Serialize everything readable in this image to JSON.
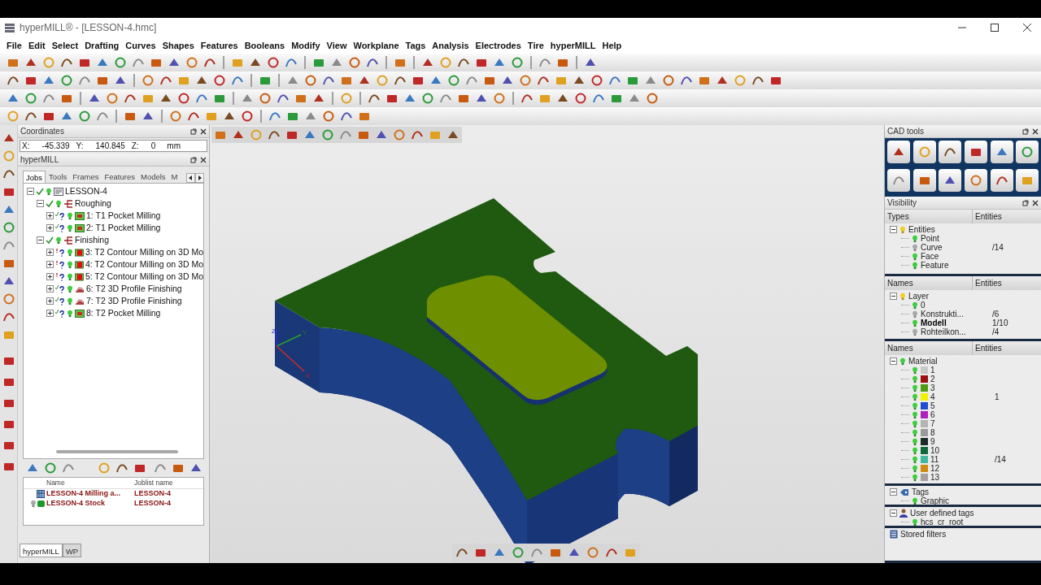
{
  "window": {
    "title": "hyperMILL® - [LESSON-4.hmc]"
  },
  "menu": [
    "File",
    "Edit",
    "Select",
    "Drafting",
    "Curves",
    "Shapes",
    "Features",
    "Booleans",
    "Modify",
    "View",
    "Workplane",
    "Tags",
    "Analysis",
    "Electrodes",
    "Tire",
    "hyperMILL",
    "Help"
  ],
  "coordinates": {
    "title": "Coordinates",
    "fields": [
      {
        "label": "X:",
        "value": "-45.339"
      },
      {
        "label": "Y:",
        "value": "140.845"
      },
      {
        "label": "Z:",
        "value": "0"
      }
    ],
    "unit": "mm"
  },
  "hypermill": {
    "title": "hyperMILL",
    "tabs": [
      {
        "label": "Jobs",
        "selected": true
      },
      {
        "label": "Tools",
        "selected": false
      },
      {
        "label": "Frames",
        "selected": false
      },
      {
        "label": "Features",
        "selected": false
      },
      {
        "label": "Models",
        "selected": false
      },
      {
        "label": "M",
        "selected": false
      }
    ],
    "tree": [
      {
        "label": "LESSON-4",
        "kind": "joblist",
        "expanded": true,
        "children": [
          {
            "label": "Roughing",
            "kind": "group",
            "expanded": true,
            "children": [
              {
                "label": "1: T1 Pocket Milling",
                "kind": "pocket",
                "expanded": false,
                "warning": false
              },
              {
                "label": "2: T1 Pocket Milling",
                "kind": "pocket",
                "expanded": false,
                "warning": false
              }
            ]
          },
          {
            "label": "Finishing",
            "kind": "group",
            "expanded": true,
            "children": [
              {
                "label": "3: T2 Contour Milling on 3D Mo",
                "kind": "contour",
                "expanded": false,
                "warning": true
              },
              {
                "label": "4: T2 Contour Milling on 3D Mo",
                "kind": "contour",
                "expanded": false,
                "warning": true
              },
              {
                "label": "5: T2 Contour Milling on 3D Mo",
                "kind": "contour",
                "expanded": false,
                "warning": true
              },
              {
                "label": "6: T2 3D Profile Finishing",
                "kind": "profile",
                "expanded": false,
                "warning": false
              },
              {
                "label": "7: T2 3D Profile Finishing",
                "kind": "profile",
                "expanded": false,
                "warning": false
              },
              {
                "label": "8: T2 Pocket Milling",
                "kind": "pocket",
                "expanded": false,
                "warning": false
              }
            ]
          }
        ]
      }
    ],
    "models": {
      "columns": [
        "Name",
        "Joblist name"
      ],
      "rows": [
        {
          "name": "LESSON-4 Milling a...",
          "joblist": "LESSON-4",
          "kind": "mesh"
        },
        {
          "name": "LESSON-4 Stock",
          "joblist": "LESSON-4",
          "kind": "stock"
        }
      ]
    },
    "bottom_tabs": [
      {
        "label": "hyperMILL",
        "selected": true
      },
      {
        "label": "WP",
        "selected": false
      }
    ]
  },
  "viewport": {
    "axes": [
      "Z",
      "Y",
      "X"
    ]
  },
  "cad_tools": {
    "title": "CAD tools"
  },
  "visibility": {
    "title": "Visibility",
    "sections": [
      {
        "columns": [
          "Types",
          "Entities"
        ],
        "tree": [
          {
            "label": "Entities",
            "kind": "folder",
            "children": [
              {
                "label": "Point",
                "visible": true
              },
              {
                "label": "Curve",
                "visible": false,
                "entities": "/14"
              },
              {
                "label": "Face",
                "visible": true
              },
              {
                "label": "Feature",
                "visible": true
              }
            ]
          }
        ]
      },
      {
        "columns": [
          "Names",
          "Entities"
        ],
        "tree": [
          {
            "label": "Layer",
            "kind": "folder",
            "children": [
              {
                "label": "0",
                "visible": true
              },
              {
                "label": "Konstrukti...",
                "visible": false,
                "entities": "/6"
              },
              {
                "label": "Modell",
                "visible": true,
                "active": true,
                "entities": "1/10"
              },
              {
                "label": "Rohteilkon...",
                "visible": false,
                "entities": "/4"
              }
            ]
          }
        ]
      },
      {
        "columns": [
          "Names",
          "Entities"
        ],
        "tree": [
          {
            "label": "Material",
            "visible": true,
            "children": [
              {
                "label": "1",
                "visible": true,
                "color": "#c8c8c8"
              },
              {
                "label": "2",
                "visible": true,
                "color": "#9b1010"
              },
              {
                "label": "3",
                "visible": true,
                "color": "#4f9a10"
              },
              {
                "label": "4",
                "visible": true,
                "color": "#f2f200",
                "entities": "1"
              },
              {
                "label": "5",
                "visible": true,
                "color": "#1f4fd0"
              },
              {
                "label": "6",
                "visible": true,
                "color": "#b020c0"
              },
              {
                "label": "7",
                "visible": true,
                "color": "#b4b4b4"
              },
              {
                "label": "8",
                "visible": true,
                "color": "#9a9a9a"
              },
              {
                "label": "9",
                "visible": true,
                "color": "#1c2a2a"
              },
              {
                "label": "10",
                "visible": true,
                "color": "#0f6a3a"
              },
              {
                "label": "11",
                "visible": true,
                "color": "#40b8a0",
                "entities": "/14"
              },
              {
                "label": "12",
                "visible": true,
                "color": "#d08a10"
              },
              {
                "label": "13",
                "visible": true,
                "color": "#a8a0a0"
              }
            ]
          }
        ]
      },
      {
        "tree": [
          {
            "label": "Tags",
            "kind": "tags",
            "children": [
              {
                "label": "Graphic",
                "visible": true
              }
            ]
          }
        ]
      },
      {
        "tree": [
          {
            "label": "User defined tags",
            "kind": "user",
            "children": [
              {
                "label": "hcs_cr_root",
                "visible": true
              }
            ]
          }
        ]
      },
      {
        "tree": [
          {
            "label": "Stored filters",
            "kind": "filters"
          }
        ]
      }
    ]
  }
}
